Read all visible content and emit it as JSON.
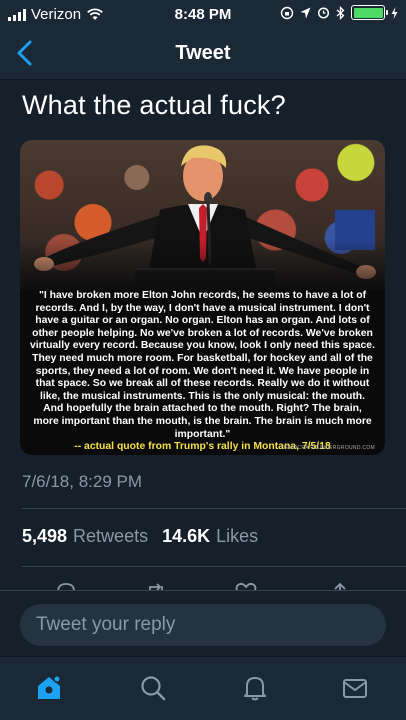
{
  "status_bar": {
    "carrier": "Verizon",
    "time": "8:48 PM"
  },
  "nav": {
    "title": "Tweet",
    "back_icon": "chevron-left-icon"
  },
  "tweet": {
    "text": "What the actual fuck?",
    "image": {
      "quote_text": "\"I have broken more Elton John records, he seems to have a lot of records. And I, by the way, I don't have a musical instrument. I don't have a guitar or an organ. No organ. Elton has an organ. And lots of other people helping. No we've broken a lot of records. We've broken virtually every record. Because you know, look I only need this space. They need much more room. For basketball, for hockey and all of the sports, they need a lot of room. We don't need it. We have people in that space. So we break all of these records. Really we do it without like, the musical instruments. This is the only musical: the mouth. And hopefully the brain attached to the mouth. Right? The brain, more important than the mouth, is the brain. The brain is much more important.\"",
      "credit": "-- actual quote from Trump's rally in Montana, 7/5/18",
      "watermark": "DEMOCRATICUNDERGROUND.COM"
    },
    "timestamp": "7/6/18, 8:29 PM",
    "retweets_count": "5,498",
    "retweets_label": "Retweets",
    "likes_count": "14.6K",
    "likes_label": "Likes"
  },
  "reply": {
    "placeholder": "Tweet your reply"
  },
  "tab_bar": {
    "items": [
      "home-icon",
      "search-icon",
      "notifications-icon",
      "messages-icon"
    ],
    "active_color": "#1da1f2",
    "inactive_color": "#8899a6"
  },
  "colors": {
    "background": "#15202b",
    "accent": "#1da1f2",
    "secondary_text": "#8899a6",
    "battery": "#4cd964"
  }
}
